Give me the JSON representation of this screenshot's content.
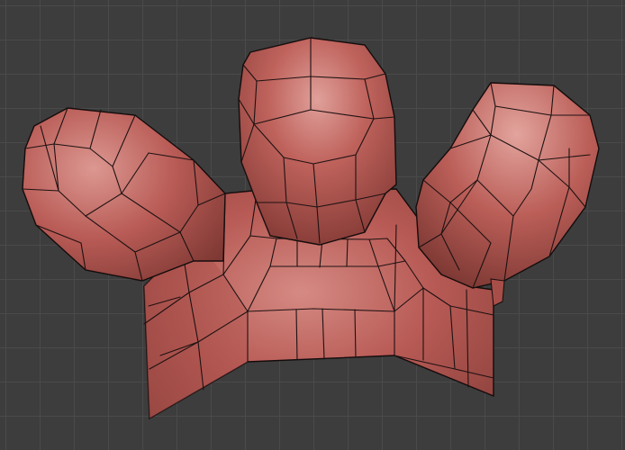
{
  "viewport": {
    "background_color": "#3d3d3d",
    "grid_color": "#4a4a4a"
  },
  "mesh": {
    "object": "low-poly-torso",
    "base_color": "#b85a55",
    "highlight_color": "#d9918a",
    "shadow_color": "#7c3733",
    "wire_color": "#1d1212",
    "parts": [
      "left-arm",
      "head-neck",
      "right-arm",
      "torso"
    ]
  }
}
